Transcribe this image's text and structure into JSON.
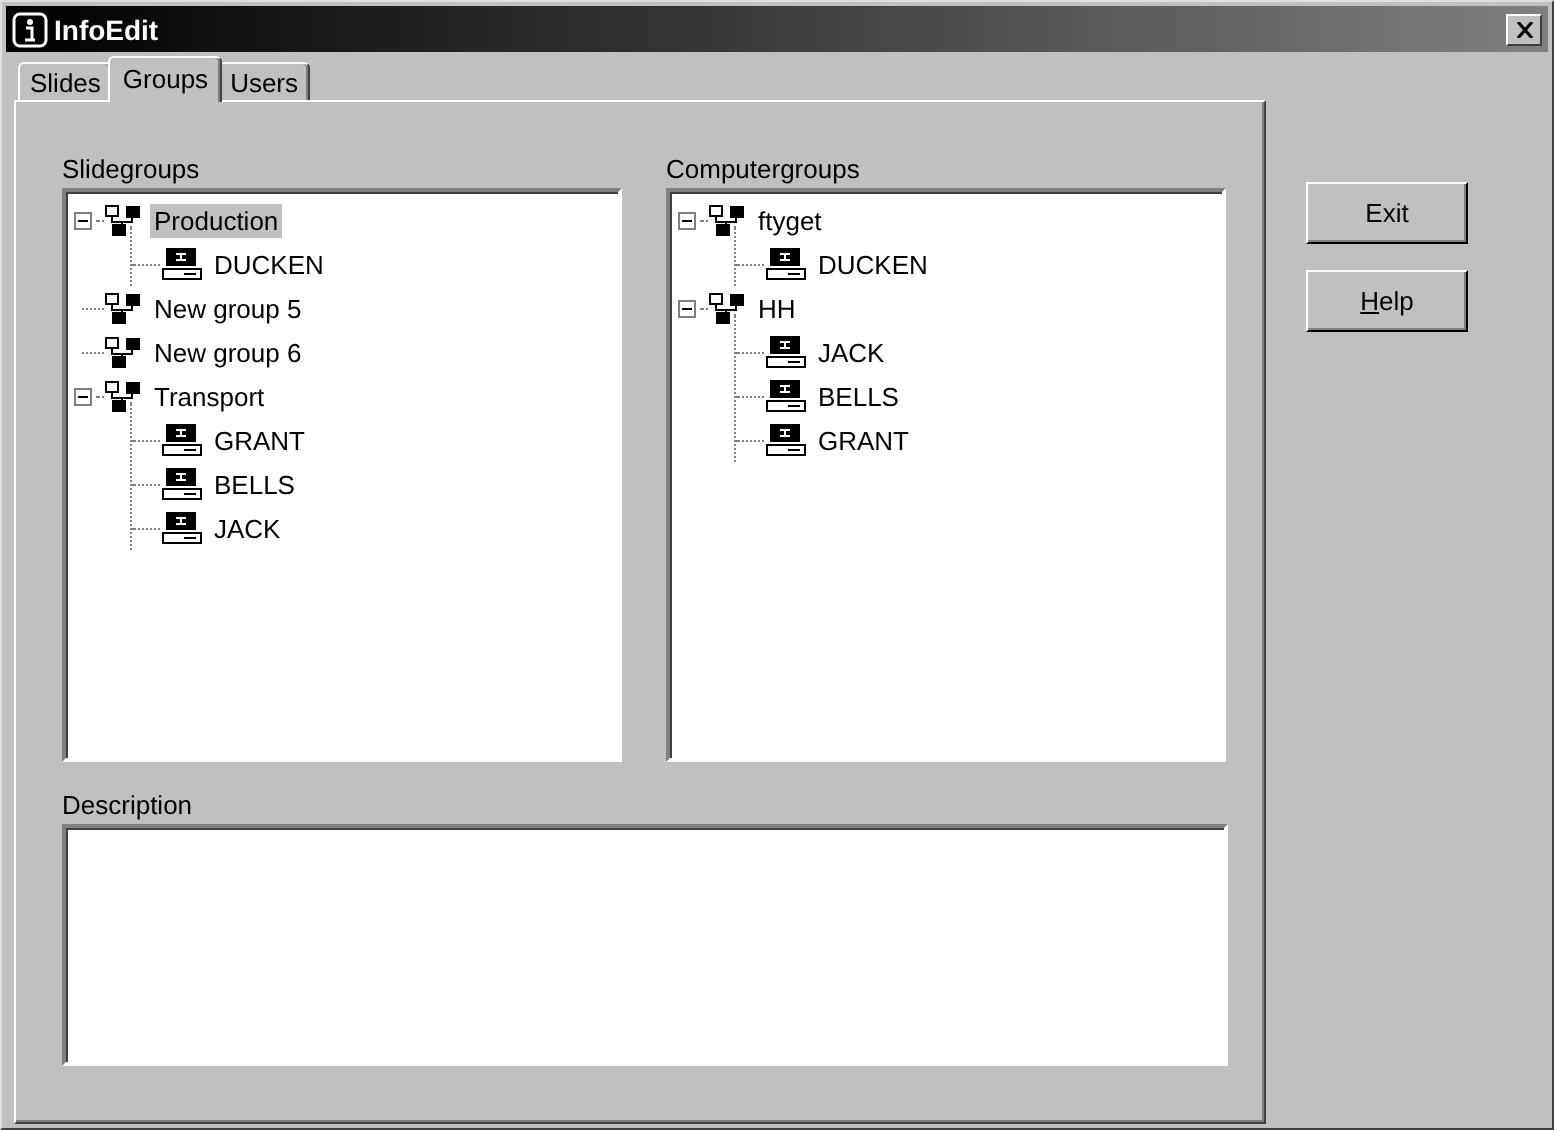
{
  "window": {
    "title": "InfoEdit"
  },
  "tabs": [
    {
      "label": "Slides",
      "selected": false
    },
    {
      "label": "Groups",
      "selected": true
    },
    {
      "label": "Users",
      "selected": false
    }
  ],
  "slidegroups": {
    "label": "Slidegroups",
    "items": [
      {
        "kind": "group",
        "label": "Production",
        "selected": true,
        "expanded": true,
        "children": [
          {
            "kind": "computer",
            "label": "DUCKEN",
            "selected": false
          }
        ]
      },
      {
        "kind": "group",
        "label": "New group 5",
        "selected": false
      },
      {
        "kind": "group",
        "label": "New group 6",
        "selected": false
      },
      {
        "kind": "group",
        "label": "Transport",
        "selected": false,
        "expanded": true,
        "children": [
          {
            "kind": "computer",
            "label": "GRANT",
            "selected": false
          },
          {
            "kind": "computer",
            "label": "BELLS",
            "selected": false
          },
          {
            "kind": "computer",
            "label": "JACK",
            "selected": false
          }
        ]
      }
    ]
  },
  "computergroups": {
    "label": "Computergroups",
    "items": [
      {
        "kind": "group",
        "label": "ftyget",
        "selected": false,
        "expanded": true,
        "children": [
          {
            "kind": "computer",
            "label": "DUCKEN",
            "selected": false
          }
        ]
      },
      {
        "kind": "group",
        "label": "HH",
        "selected": false,
        "expanded": true,
        "children": [
          {
            "kind": "computer",
            "label": "JACK",
            "selected": false
          },
          {
            "kind": "computer",
            "label": "BELLS",
            "selected": false
          },
          {
            "kind": "computer",
            "label": "GRANT",
            "selected": false
          }
        ]
      }
    ]
  },
  "description": {
    "label": "Description"
  },
  "buttons": [
    {
      "label": "Exit",
      "mnemonic": false
    },
    {
      "label": "Help",
      "mnemonic": true
    }
  ]
}
